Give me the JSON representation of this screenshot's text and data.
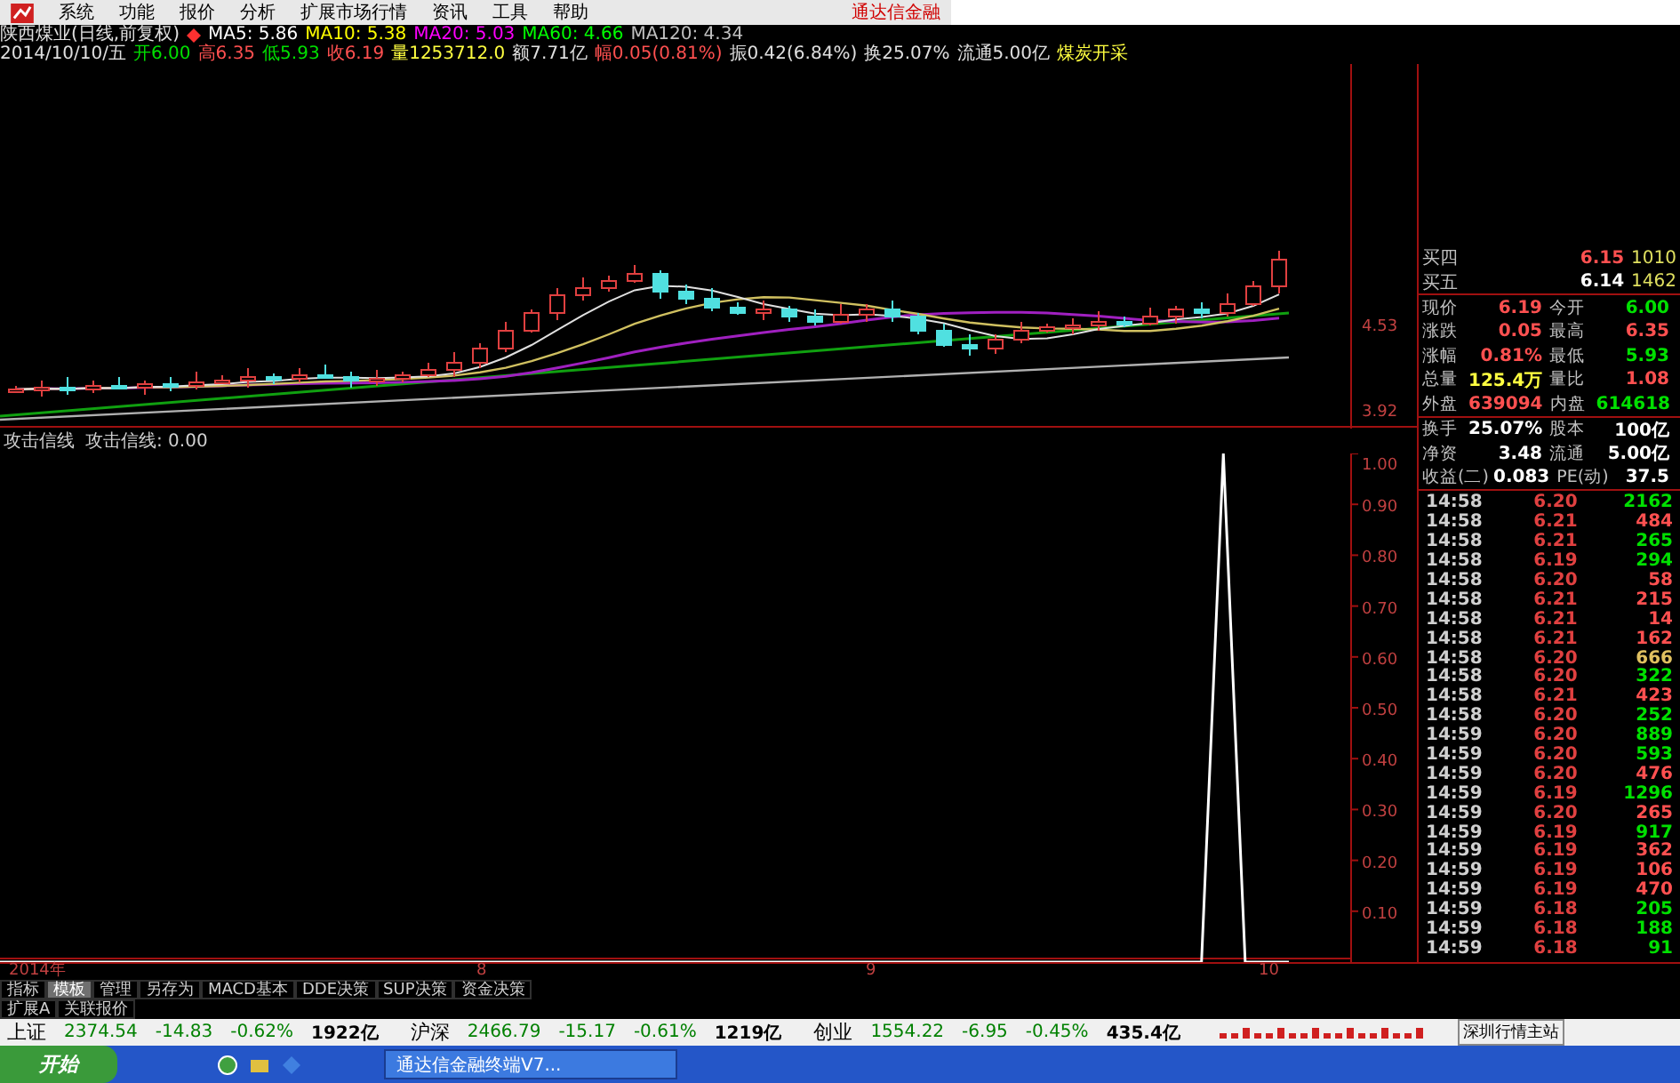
{
  "menu": {
    "items": [
      "系统",
      "功能",
      "报价",
      "分析",
      "扩展市场行情",
      "资讯",
      "工具",
      "帮助"
    ],
    "brand": "通达信金融"
  },
  "header": {
    "title": "陕西煤业(日线,前复权)",
    "ma": [
      {
        "label": "MA5: 5.86",
        "color": "#ffffff"
      },
      {
        "label": "MA10: 5.38",
        "color": "#ffff00"
      },
      {
        "label": "MA20: 5.03",
        "color": "#ff00ff"
      },
      {
        "label": "MA60: 4.66",
        "color": "#00ff00"
      },
      {
        "label": "MA120: 4.34",
        "color": "#c0c0c0"
      }
    ],
    "date": "2014/10/10/五",
    "fields": [
      {
        "text": "开6.00",
        "color": "#00e000"
      },
      {
        "text": "高6.35",
        "color": "#ff5050"
      },
      {
        "text": "低5.93",
        "color": "#00e000"
      },
      {
        "text": "收6.19",
        "color": "#ff5050"
      },
      {
        "text": "量1253712.0",
        "color": "#ffff40"
      },
      {
        "text": "额7.71亿",
        "color": "#e0e0e0"
      },
      {
        "text": "幅0.05(0.81%)",
        "color": "#ff5050"
      },
      {
        "text": "振0.42(6.84%)",
        "color": "#e0e0e0"
      },
      {
        "text": "换25.07%",
        "color": "#e0e0e0"
      },
      {
        "text": "流通5.00亿",
        "color": "#e0e0e0"
      },
      {
        "text": "煤炭开采",
        "color": "#ffff40"
      }
    ]
  },
  "price_chart": {
    "axis_labels": [
      "4.53",
      "3.92"
    ]
  },
  "indicator": {
    "reading": "攻击信线: 0.00",
    "chart_data": {
      "type": "line",
      "title": "攻击信线",
      "series": [
        {
          "color": "#ffffff",
          "values": [
            0,
            0,
            0,
            0,
            0,
            0,
            0,
            0,
            0,
            0,
            0,
            0,
            0,
            0,
            0,
            0,
            0,
            0,
            0,
            0,
            0,
            0,
            0,
            0,
            0,
            0,
            0,
            0,
            0,
            0,
            0,
            0,
            0,
            0,
            0,
            0,
            0,
            0,
            0,
            0,
            0,
            0,
            0,
            0,
            0,
            0,
            0,
            0,
            0,
            0,
            0,
            0,
            0,
            0,
            0,
            0,
            1,
            0,
            0,
            0
          ]
        }
      ],
      "ylim": [
        0,
        1
      ],
      "yticks": [
        {
          "value": 1,
          "label": "1.00"
        },
        {
          "value": 0.9,
          "label": "0.90"
        },
        {
          "value": 0.8,
          "label": "0.80"
        },
        {
          "value": 0.7,
          "label": "0.70"
        },
        {
          "value": 0.6,
          "label": "0.60"
        },
        {
          "value": 0.5,
          "label": "0.50"
        },
        {
          "value": 0.4,
          "label": "0.40"
        },
        {
          "value": 0.3,
          "label": "0.30"
        },
        {
          "value": 0.2,
          "label": "0.20"
        },
        {
          "value": 0.1,
          "label": "0.10"
        }
      ]
    }
  },
  "time_axis": [
    "2014年",
    "8",
    "9",
    "10"
  ],
  "quote": {
    "depth": [
      {
        "label": "买四",
        "price": "6.15",
        "volume": "1010",
        "color": "#ff5050"
      },
      {
        "label": "买五",
        "price": "6.14",
        "volume": "1462",
        "color": "#ffffff"
      }
    ],
    "stats": [
      [
        {
          "label": "现价",
          "value": "6.19",
          "color": "#ff5050"
        },
        {
          "label": "今开",
          "value": "6.00",
          "color": "#00e000"
        }
      ],
      [
        {
          "label": "涨跌",
          "value": "0.05",
          "color": "#ff5050"
        },
        {
          "label": "最高",
          "value": "6.35",
          "color": "#ff5050"
        }
      ],
      [
        {
          "label": "涨幅",
          "value": "0.81%",
          "color": "#ff5050"
        },
        {
          "label": "最低",
          "value": "5.93",
          "color": "#00e000"
        }
      ],
      [
        {
          "label": "总量",
          "value": "125.4万",
          "color": "#ffff40"
        },
        {
          "label": "量比",
          "value": "1.08",
          "color": "#ff5050"
        }
      ],
      [
        {
          "label": "外盘",
          "value": "639094",
          "color": "#ff5050"
        },
        {
          "label": "内盘",
          "value": "614618",
          "color": "#00e000"
        }
      ],
      [
        {
          "label": "换手",
          "value": "25.07%",
          "color": "#ffffff"
        },
        {
          "label": "股本",
          "value": "100亿",
          "color": "#ffffff"
        }
      ],
      [
        {
          "label": "净资",
          "value": "3.48",
          "color": "#ffffff"
        },
        {
          "label": "流通",
          "value": "5.00亿",
          "color": "#ffffff"
        }
      ],
      [
        {
          "label": "收益(二)",
          "value": "0.083",
          "color": "#ffffff"
        },
        {
          "label": "PE(动)",
          "value": "37.5",
          "color": "#ffffff"
        }
      ]
    ]
  },
  "ticks": [
    {
      "time": "14:58",
      "price": "6.20",
      "volume": "2162",
      "color": "#00e000"
    },
    {
      "time": "14:58",
      "price": "6.21",
      "volume": "484",
      "color": "#ff5050"
    },
    {
      "time": "14:58",
      "price": "6.21",
      "volume": "265",
      "color": "#00e000"
    },
    {
      "time": "14:58",
      "price": "6.19",
      "volume": "294",
      "color": "#00e000"
    },
    {
      "time": "14:58",
      "price": "6.20",
      "volume": "58",
      "color": "#ff5050"
    },
    {
      "time": "14:58",
      "price": "6.21",
      "volume": "215",
      "color": "#ff5050"
    },
    {
      "time": "14:58",
      "price": "6.21",
      "volume": "14",
      "color": "#ff5050"
    },
    {
      "time": "14:58",
      "price": "6.21",
      "volume": "162",
      "color": "#ff5050"
    },
    {
      "time": "14:58",
      "price": "6.20",
      "volume": "666",
      "color": "#e0c060"
    },
    {
      "time": "14:58",
      "price": "6.20",
      "volume": "322",
      "color": "#00e000"
    },
    {
      "time": "14:58",
      "price": "6.21",
      "volume": "423",
      "color": "#ff5050"
    },
    {
      "time": "14:58",
      "price": "6.20",
      "volume": "252",
      "color": "#00e000"
    },
    {
      "time": "14:59",
      "price": "6.20",
      "volume": "889",
      "color": "#00e000"
    },
    {
      "time": "14:59",
      "price": "6.20",
      "volume": "593",
      "color": "#00e000"
    },
    {
      "time": "14:59",
      "price": "6.20",
      "volume": "476",
      "color": "#ff5050"
    },
    {
      "time": "14:59",
      "price": "6.19",
      "volume": "1296",
      "color": "#00e000"
    },
    {
      "time": "14:59",
      "price": "6.20",
      "volume": "265",
      "color": "#ff5050"
    },
    {
      "time": "14:59",
      "price": "6.19",
      "volume": "917",
      "color": "#00e000"
    },
    {
      "time": "14:59",
      "price": "6.19",
      "volume": "362",
      "color": "#ff5050"
    },
    {
      "time": "14:59",
      "price": "6.19",
      "volume": "106",
      "color": "#ff5050"
    },
    {
      "time": "14:59",
      "price": "6.19",
      "volume": "470",
      "color": "#ff5050"
    },
    {
      "time": "14:59",
      "price": "6.18",
      "volume": "205",
      "color": "#00e000"
    },
    {
      "time": "14:59",
      "price": "6.18",
      "volume": "188",
      "color": "#00e000"
    },
    {
      "time": "14:59",
      "price": "6.18",
      "volume": "91",
      "color": "#00e000"
    }
  ],
  "tabs": [
    {
      "label": "指标",
      "selected": false
    },
    {
      "label": "模板",
      "selected": true
    },
    {
      "label": "管理",
      "selected": false
    },
    {
      "label": "另存为",
      "selected": false
    },
    {
      "label": "MACD基本",
      "selected": false
    },
    {
      "label": "DDE决策",
      "selected": false
    },
    {
      "label": "SUP决策",
      "selected": false
    },
    {
      "label": "资金决策",
      "selected": false
    }
  ],
  "tabs_row2": [
    {
      "label": "扩展A",
      "selected": false
    },
    {
      "label": "关联报价",
      "selected": false
    }
  ],
  "status_bar": {
    "indices": [
      {
        "name": "上证",
        "value": "2374.54",
        "change": "-14.83",
        "percent": "-0.62%",
        "amount": "1922亿"
      },
      {
        "name": "沪深",
        "value": "2466.79",
        "change": "-15.17",
        "percent": "-0.61%",
        "amount": "1219亿"
      },
      {
        "name": "创业",
        "value": "1554.22",
        "change": "-6.95",
        "percent": "-0.45%",
        "amount": "435.4亿"
      }
    ],
    "server": "深圳行情主站"
  },
  "taskbar": {
    "start": "开始",
    "task": "通达信金融终端V7..."
  }
}
